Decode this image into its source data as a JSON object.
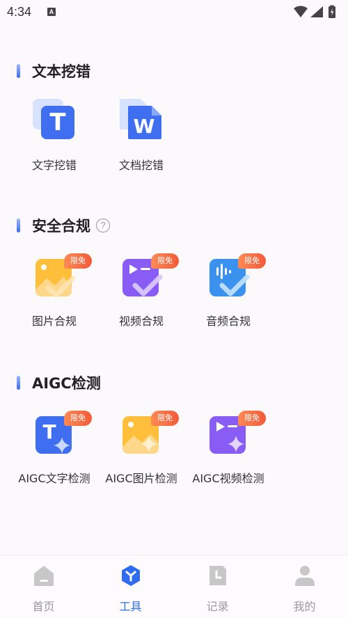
{
  "status_bar": {
    "time": "4:34",
    "notification_glyph": "A"
  },
  "sections": {
    "text": {
      "title": "文本挖错",
      "items": [
        {
          "label": "文字挖错",
          "icon": "text-t-icon"
        },
        {
          "label": "文档挖错",
          "icon": "document-w-icon"
        }
      ]
    },
    "compliance": {
      "title": "安全合规",
      "help_glyph": "?",
      "items": [
        {
          "label": "图片合规",
          "badge": "限免",
          "icon": "image-check-icon"
        },
        {
          "label": "视频合规",
          "badge": "限免",
          "icon": "video-check-icon"
        },
        {
          "label": "音频合规",
          "badge": "限免",
          "icon": "audio-check-icon"
        }
      ]
    },
    "aigc": {
      "title": "AIGC检测",
      "items": [
        {
          "label": "AIGC文字检测",
          "badge": "限免",
          "icon": "ai-text-icon"
        },
        {
          "label": "AIGC图片检测",
          "badge": "限免",
          "icon": "ai-image-icon"
        },
        {
          "label": "AIGC视频检测",
          "badge": "限免",
          "icon": "ai-video-icon"
        }
      ]
    }
  },
  "icon_letters": {
    "t": "T",
    "w": "W"
  },
  "bottom_nav": [
    {
      "label": "首页",
      "active": false
    },
    {
      "label": "工具",
      "active": true
    },
    {
      "label": "记录",
      "active": false
    },
    {
      "label": "我的",
      "active": false
    }
  ],
  "colors": {
    "accent": "#2f6cf0",
    "badge": "#f25b3a",
    "inactive_nav": "#9a9a9a"
  }
}
